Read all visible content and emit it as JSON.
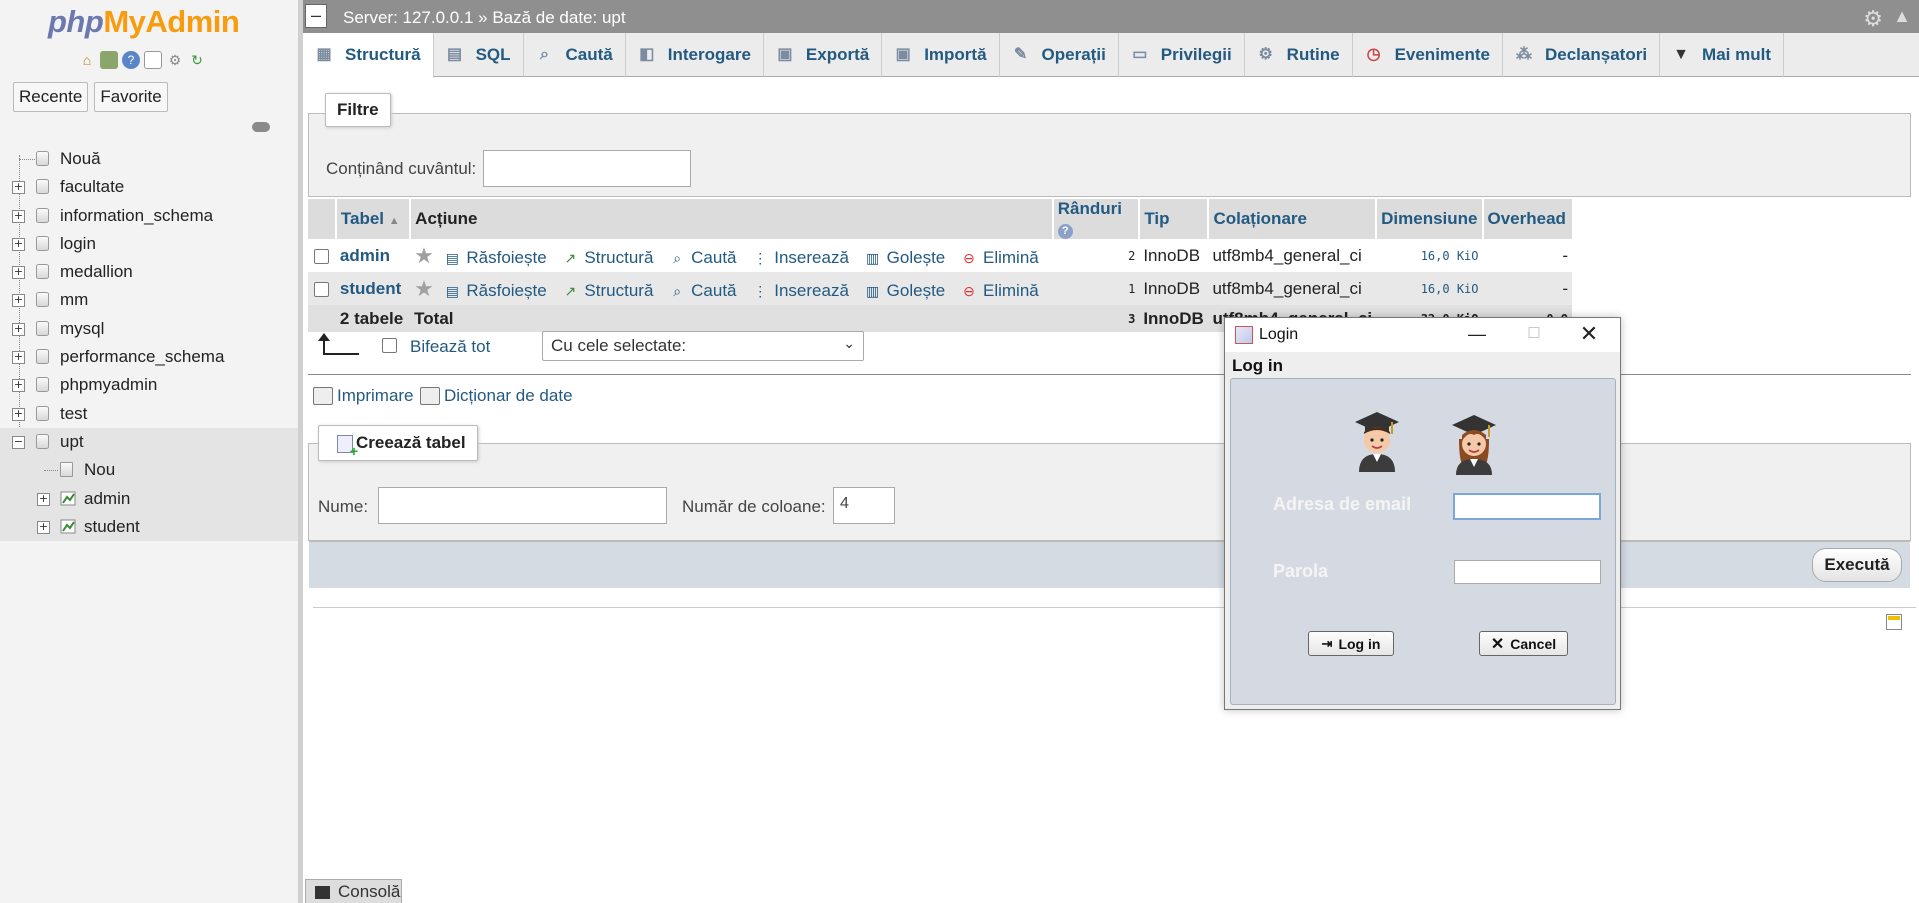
{
  "sidebar": {
    "logo": {
      "php": "php",
      "my": "My",
      "admin": "Admin"
    },
    "tabs": {
      "recent": "Recente",
      "favorites": "Favorite"
    },
    "tree": [
      {
        "label": "Nouă"
      },
      {
        "label": "facultate"
      },
      {
        "label": "information_schema"
      },
      {
        "label": "login"
      },
      {
        "label": "medallion"
      },
      {
        "label": "mm"
      },
      {
        "label": "mysql"
      },
      {
        "label": "performance_schema"
      },
      {
        "label": "phpmyadmin"
      },
      {
        "label": "test"
      },
      {
        "label": "upt"
      },
      {
        "label": "Nou"
      },
      {
        "label": "admin"
      },
      {
        "label": "student"
      }
    ]
  },
  "topbar": {
    "breadcrumb": "Server: 127.0.0.1 » Bază de date: upt"
  },
  "tabs": [
    {
      "label": "Structură",
      "icon": "structure-icon"
    },
    {
      "label": "SQL",
      "icon": "sql-icon"
    },
    {
      "label": "Caută",
      "icon": "search-icon"
    },
    {
      "label": "Interogare",
      "icon": "query-icon"
    },
    {
      "label": "Exportă",
      "icon": "export-icon"
    },
    {
      "label": "Importă",
      "icon": "import-icon"
    },
    {
      "label": "Operații",
      "icon": "wrench-icon"
    },
    {
      "label": "Privilegii",
      "icon": "privileges-icon"
    },
    {
      "label": "Rutine",
      "icon": "routines-icon"
    },
    {
      "label": "Evenimente",
      "icon": "events-icon"
    },
    {
      "label": "Declanșatori",
      "icon": "triggers-icon"
    },
    {
      "label": "Mai mult",
      "icon": "more-icon"
    }
  ],
  "filters": {
    "legend": "Filtre",
    "label": "Conținând cuvântul:",
    "value": ""
  },
  "table": {
    "headers": {
      "table": "Tabel",
      "action": "Acțiune",
      "rows": "Rânduri",
      "type": "Tip",
      "collation": "Colaționare",
      "size": "Dimensiune",
      "overhead": "Overhead"
    },
    "actions": {
      "browse": "Răsfoiește",
      "structure": "Structură",
      "search": "Caută",
      "insert": "Inserează",
      "empty": "Golește",
      "drop": "Elimină"
    },
    "rows": [
      {
        "name": "admin",
        "rows": "2",
        "type": "InnoDB",
        "collation": "utf8mb4_general_ci",
        "size": "16,0 KiO",
        "overhead": "-"
      },
      {
        "name": "student",
        "rows": "1",
        "type": "InnoDB",
        "collation": "utf8mb4_general_ci",
        "size": "16,0 KiO",
        "overhead": "-"
      }
    ],
    "footer": {
      "count": "2 tabele",
      "label": "Total",
      "rows": "3",
      "type": "InnoDB",
      "collation": "utf8mb4_general_ci",
      "size": "32,0 KiO",
      "overhead": "0 O"
    }
  },
  "bulk": {
    "check_all": "Bifează tot",
    "with_selected": "Cu cele selectate:"
  },
  "links": {
    "print": "Imprimare",
    "dictionary": "Dicționar de date"
  },
  "create": {
    "legend": "Creează tabel",
    "name_label": "Nume:",
    "name_value": "",
    "cols_label": "Număr de coloane:",
    "cols_value": "4",
    "execute": "Execută"
  },
  "console": {
    "label": "Consolă"
  },
  "dialog": {
    "title": "Login",
    "heading": "Log in",
    "email_label": "Adresa de email",
    "email_value": "",
    "password_label": "Parola",
    "password_value": "",
    "login_button": "Log in",
    "cancel_button": "Cancel"
  }
}
